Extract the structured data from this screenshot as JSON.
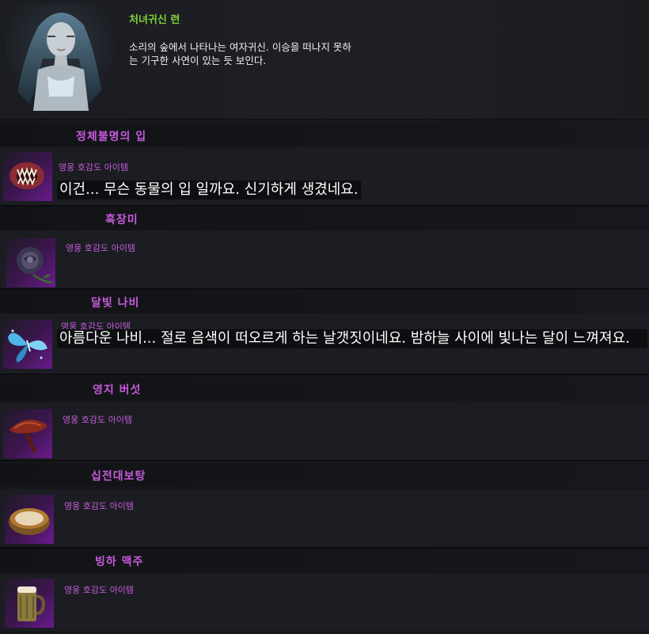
{
  "npc": {
    "name": "처녀귀신 련",
    "description": "소리의 숲에서 나타나는 여자귀신. 이승을 떠나지 못하는 기구한 사연이 있는 듯 보인다."
  },
  "items": [
    {
      "name": "정체불명의 입",
      "tag": "영웅 호감도 아이템",
      "speech": "이건... 무슨 동물의 입 일까요. 신기하게 생겼네요.",
      "icon": "monster-mouth-icon"
    },
    {
      "name": "흑장미",
      "tag": "영웅 호감도 아이템",
      "speech": "",
      "icon": "black-rose-icon"
    },
    {
      "name": "달빛 나비",
      "tag": "영웅 호감도 아이템",
      "speech": "아름다운 나비... 절로 음색이 떠오르게 하는 날갯짓이네요. 밤하늘 사이에 빛나는 달이 느껴져요.",
      "icon": "moonlight-butterfly-icon"
    },
    {
      "name": "영지 버섯",
      "tag": "영웅 호감도 아이템",
      "speech": "",
      "icon": "reishi-mushroom-icon"
    },
    {
      "name": "십전대보탕",
      "tag": "영웅 호감도 아이템",
      "speech": "",
      "icon": "herbal-soup-bowl-icon"
    },
    {
      "name": "빙하 맥주",
      "tag": "영웅 호감도 아이템",
      "speech": "",
      "icon": "beer-mug-icon"
    }
  ]
}
